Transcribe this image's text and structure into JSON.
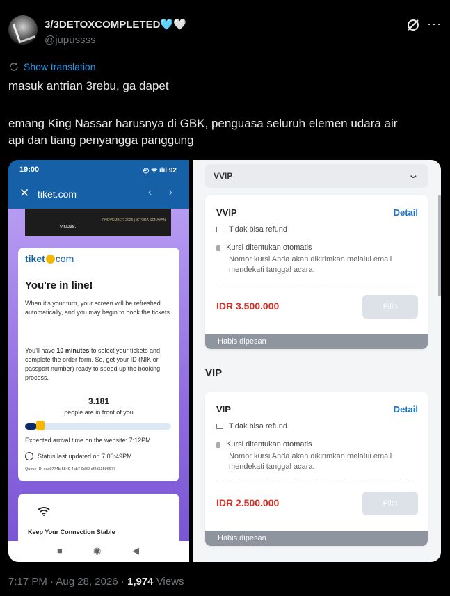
{
  "tweet": {
    "display_name": "3/3DETOXCOMPLETED",
    "name_emojis": "🩵🤍",
    "handle": "@jupussss",
    "show_translation": "Show translation",
    "text_line1": "masuk antrian 3rebu, ga dapet",
    "text_line2": "emang King Nassar harusnya di GBK, penguasa seluruh elemen udara air",
    "text_line3": "api dan tiang penyangga panggung",
    "time": "7:17 PM",
    "date": "Aug 28, 2026",
    "views_count": "1,974",
    "views_label": "Views"
  },
  "phone": {
    "status_time": "19:00",
    "status_icons": "◴ ᯤ ılıl 92",
    "close_icon": "✕",
    "url": "tiket.com",
    "nav_icons": "‹ ›",
    "banner_text": "7 NOVEMBER 2026 | ISTORA SENAYAN",
    "banner_logo": "VIND3S.",
    "brand_tiket": "tiket",
    "brand_com": "com",
    "title": "You're in line!",
    "para1": "When it's your turn, your screen will be refreshed automatically, and you may begin to book the tickets.",
    "para2_pre": "You'll have ",
    "para2_bold": "10 minutes",
    "para2_post": " to select your tickets and complete the order form. So, get your ID (NIK or passport number) ready to speed up the booking process.",
    "queue_count": "3.181",
    "queue_label": "people are in front of you",
    "queue_progress": 0.08,
    "eta": "Expected arrival time on the website: 7:12PM",
    "updated": "Status last updated on 7:00:49PM",
    "queue_id": "Queue ID: eac0774b-5849-4ab7-9d39-df2d13596677",
    "connection_label": "Keep Your Connection Stable",
    "nav_square": "■",
    "nav_circle": "◉",
    "nav_back": "◀"
  },
  "tickets": {
    "dropdown_value": "VVIP",
    "section_vip": "VIP",
    "items": [
      {
        "name": "VVIP",
        "detail": "Detail",
        "refund": "Tidak bisa refund",
        "seat": "Kursi ditentukan otomatis",
        "seat_sub": "Nomor kursi Anda akan dikirimkan melalui email mendekati tanggal acara.",
        "price": "IDR 3.500.000",
        "button": "Pilih",
        "status": "Habis dipesan"
      },
      {
        "name": "VIP",
        "detail": "Detail",
        "refund": "Tidak bisa refund",
        "seat": "Kursi ditentukan otomatis",
        "seat_sub": "Nomor kursi Anda akan dikirimkan melalui email mendekati tanggal acara.",
        "price": "IDR 2.500.000",
        "button": "Pilih",
        "status": "Habis dipesan"
      }
    ]
  },
  "colors": {
    "link": "#1d9bf0",
    "price": "#d93025",
    "brand": "#1560a6"
  },
  "icons": {
    "grok": "grok-icon",
    "more": "more-icon",
    "translate": "translate-icon",
    "chevron": "chevron-down-icon"
  }
}
